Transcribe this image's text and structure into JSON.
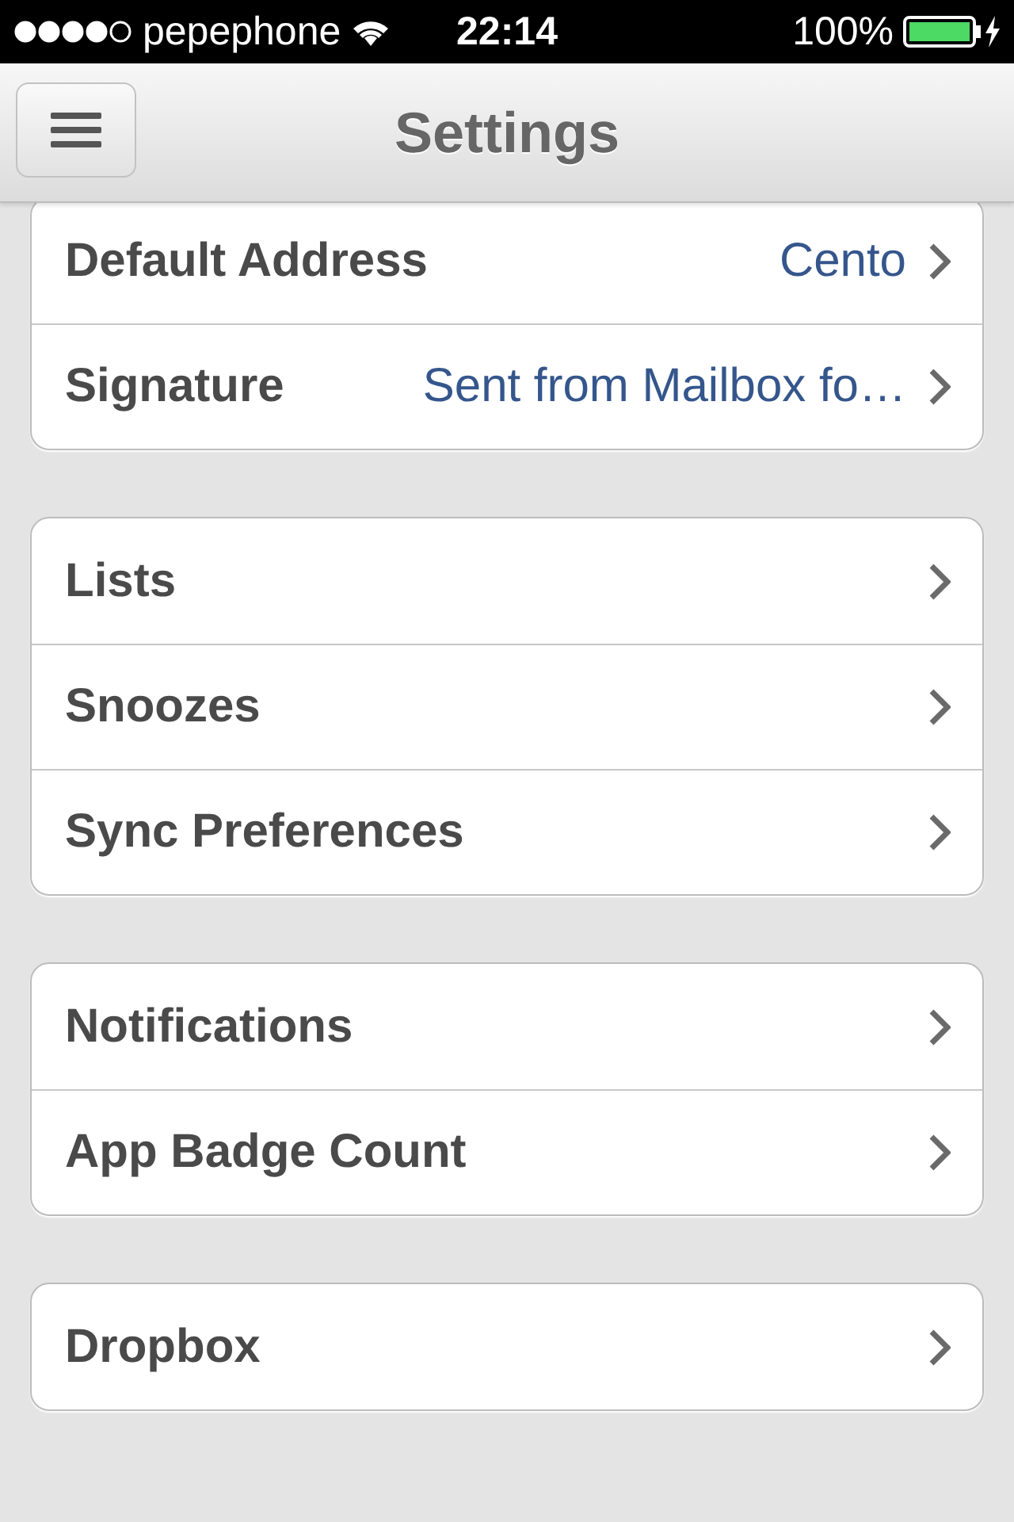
{
  "status_bar": {
    "carrier": "pepephone",
    "time": "22:14",
    "battery": "100%"
  },
  "nav_bar": {
    "title": "Settings"
  },
  "groups": [
    {
      "rows": [
        {
          "label": "Default Address",
          "value": "Cento"
        },
        {
          "label": "Signature",
          "value": "Sent from Mailbox fo…"
        }
      ]
    },
    {
      "rows": [
        {
          "label": "Lists"
        },
        {
          "label": "Snoozes"
        },
        {
          "label": "Sync Preferences"
        }
      ]
    },
    {
      "rows": [
        {
          "label": "Notifications"
        },
        {
          "label": "App Badge Count"
        }
      ]
    },
    {
      "rows": [
        {
          "label": "Dropbox"
        }
      ]
    }
  ]
}
